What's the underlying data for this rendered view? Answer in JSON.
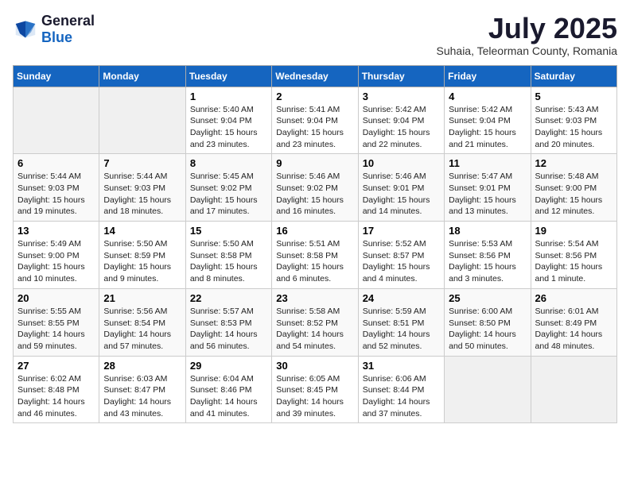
{
  "logo": {
    "general": "General",
    "blue": "Blue"
  },
  "title": {
    "month": "July 2025",
    "location": "Suhaia, Teleorman County, Romania"
  },
  "days_of_week": [
    "Sunday",
    "Monday",
    "Tuesday",
    "Wednesday",
    "Thursday",
    "Friday",
    "Saturday"
  ],
  "weeks": [
    [
      {
        "day": "",
        "info": ""
      },
      {
        "day": "",
        "info": ""
      },
      {
        "day": "1",
        "info": "Sunrise: 5:40 AM\nSunset: 9:04 PM\nDaylight: 15 hours and 23 minutes."
      },
      {
        "day": "2",
        "info": "Sunrise: 5:41 AM\nSunset: 9:04 PM\nDaylight: 15 hours and 23 minutes."
      },
      {
        "day": "3",
        "info": "Sunrise: 5:42 AM\nSunset: 9:04 PM\nDaylight: 15 hours and 22 minutes."
      },
      {
        "day": "4",
        "info": "Sunrise: 5:42 AM\nSunset: 9:04 PM\nDaylight: 15 hours and 21 minutes."
      },
      {
        "day": "5",
        "info": "Sunrise: 5:43 AM\nSunset: 9:03 PM\nDaylight: 15 hours and 20 minutes."
      }
    ],
    [
      {
        "day": "6",
        "info": "Sunrise: 5:44 AM\nSunset: 9:03 PM\nDaylight: 15 hours and 19 minutes."
      },
      {
        "day": "7",
        "info": "Sunrise: 5:44 AM\nSunset: 9:03 PM\nDaylight: 15 hours and 18 minutes."
      },
      {
        "day": "8",
        "info": "Sunrise: 5:45 AM\nSunset: 9:02 PM\nDaylight: 15 hours and 17 minutes."
      },
      {
        "day": "9",
        "info": "Sunrise: 5:46 AM\nSunset: 9:02 PM\nDaylight: 15 hours and 16 minutes."
      },
      {
        "day": "10",
        "info": "Sunrise: 5:46 AM\nSunset: 9:01 PM\nDaylight: 15 hours and 14 minutes."
      },
      {
        "day": "11",
        "info": "Sunrise: 5:47 AM\nSunset: 9:01 PM\nDaylight: 15 hours and 13 minutes."
      },
      {
        "day": "12",
        "info": "Sunrise: 5:48 AM\nSunset: 9:00 PM\nDaylight: 15 hours and 12 minutes."
      }
    ],
    [
      {
        "day": "13",
        "info": "Sunrise: 5:49 AM\nSunset: 9:00 PM\nDaylight: 15 hours and 10 minutes."
      },
      {
        "day": "14",
        "info": "Sunrise: 5:50 AM\nSunset: 8:59 PM\nDaylight: 15 hours and 9 minutes."
      },
      {
        "day": "15",
        "info": "Sunrise: 5:50 AM\nSunset: 8:58 PM\nDaylight: 15 hours and 8 minutes."
      },
      {
        "day": "16",
        "info": "Sunrise: 5:51 AM\nSunset: 8:58 PM\nDaylight: 15 hours and 6 minutes."
      },
      {
        "day": "17",
        "info": "Sunrise: 5:52 AM\nSunset: 8:57 PM\nDaylight: 15 hours and 4 minutes."
      },
      {
        "day": "18",
        "info": "Sunrise: 5:53 AM\nSunset: 8:56 PM\nDaylight: 15 hours and 3 minutes."
      },
      {
        "day": "19",
        "info": "Sunrise: 5:54 AM\nSunset: 8:56 PM\nDaylight: 15 hours and 1 minute."
      }
    ],
    [
      {
        "day": "20",
        "info": "Sunrise: 5:55 AM\nSunset: 8:55 PM\nDaylight: 14 hours and 59 minutes."
      },
      {
        "day": "21",
        "info": "Sunrise: 5:56 AM\nSunset: 8:54 PM\nDaylight: 14 hours and 57 minutes."
      },
      {
        "day": "22",
        "info": "Sunrise: 5:57 AM\nSunset: 8:53 PM\nDaylight: 14 hours and 56 minutes."
      },
      {
        "day": "23",
        "info": "Sunrise: 5:58 AM\nSunset: 8:52 PM\nDaylight: 14 hours and 54 minutes."
      },
      {
        "day": "24",
        "info": "Sunrise: 5:59 AM\nSunset: 8:51 PM\nDaylight: 14 hours and 52 minutes."
      },
      {
        "day": "25",
        "info": "Sunrise: 6:00 AM\nSunset: 8:50 PM\nDaylight: 14 hours and 50 minutes."
      },
      {
        "day": "26",
        "info": "Sunrise: 6:01 AM\nSunset: 8:49 PM\nDaylight: 14 hours and 48 minutes."
      }
    ],
    [
      {
        "day": "27",
        "info": "Sunrise: 6:02 AM\nSunset: 8:48 PM\nDaylight: 14 hours and 46 minutes."
      },
      {
        "day": "28",
        "info": "Sunrise: 6:03 AM\nSunset: 8:47 PM\nDaylight: 14 hours and 43 minutes."
      },
      {
        "day": "29",
        "info": "Sunrise: 6:04 AM\nSunset: 8:46 PM\nDaylight: 14 hours and 41 minutes."
      },
      {
        "day": "30",
        "info": "Sunrise: 6:05 AM\nSunset: 8:45 PM\nDaylight: 14 hours and 39 minutes."
      },
      {
        "day": "31",
        "info": "Sunrise: 6:06 AM\nSunset: 8:44 PM\nDaylight: 14 hours and 37 minutes."
      },
      {
        "day": "",
        "info": ""
      },
      {
        "day": "",
        "info": ""
      }
    ]
  ]
}
